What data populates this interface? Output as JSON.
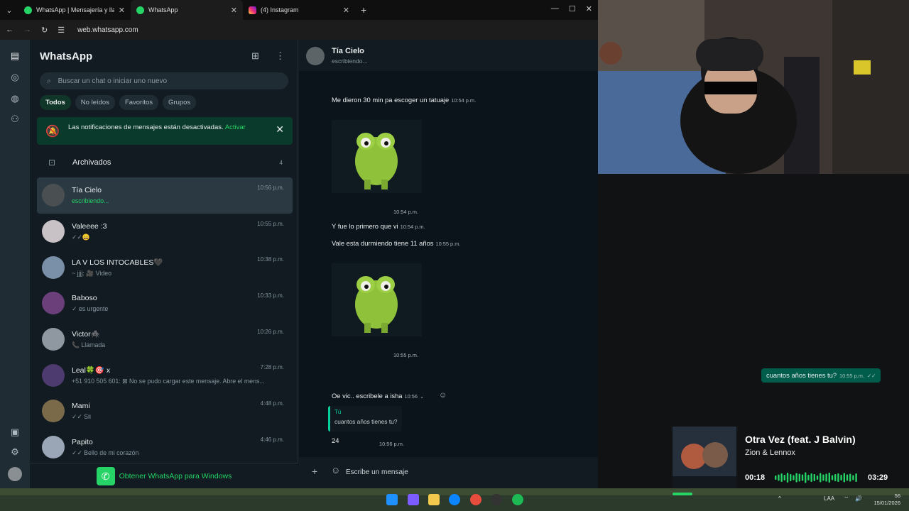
{
  "browser": {
    "tabs": [
      {
        "title": "WhatsApp | Mensajería y llama...",
        "active": false
      },
      {
        "title": "WhatsApp",
        "active": true
      },
      {
        "title": "(4) Instagram",
        "active": false
      }
    ],
    "url": "web.whatsapp.com"
  },
  "sidebar": {
    "title": "WhatsApp",
    "search_placeholder": "Buscar un chat o iniciar uno nuevo",
    "filters": [
      "Todos",
      "No leídos",
      "Favoritos",
      "Grupos"
    ],
    "active_filter": "Todos",
    "notification": {
      "text": "Las notificaciones de mensajes están desactivadas.",
      "action": "Activar"
    },
    "archived": {
      "label": "Archivados",
      "count": "4"
    },
    "chats": [
      {
        "name": "Tía Cielo",
        "preview": "escribiendo...",
        "time": "10:56 p.m.",
        "selected": true,
        "avatar_color": "#4a4f52"
      },
      {
        "name": "Valeeee :3",
        "preview": "✓✓😄",
        "time": "10:55 p.m.",
        "avatar_color": "#c8c2c6"
      },
      {
        "name": "LA V LOS INTOCABLES🖤",
        "preview": "~ jjjj: 🎥 Video",
        "time": "10:38 p.m.",
        "avatar_color": "#7a8fa8"
      },
      {
        "name": "Baboso",
        "preview": "✓ es urgente",
        "time": "10:33 p.m.",
        "avatar_color": "#6b3f7a"
      },
      {
        "name": "Victor🕷️",
        "preview": "📞 Llamada",
        "time": "10:26 p.m.",
        "avatar_color": "#8f97a0"
      },
      {
        "name": "Leal🍀🎯 x",
        "preview": "+51 910 505 601: ⊠ No se pudo cargar este mensaje. Abre el mens...",
        "time": "7:28 p.m.",
        "avatar_color": "#4d3a6e"
      },
      {
        "name": "Mami",
        "preview": "✓✓ Sii",
        "time": "4:48 p.m.",
        "avatar_color": "#7a6a4a"
      },
      {
        "name": "Papito",
        "preview": "✓✓ Bello de mi corazón",
        "time": "4:46 p.m.",
        "avatar_color": "#9aa6b5"
      }
    ],
    "get_windows_label": "Obtener WhatsApp para Windows"
  },
  "conversation": {
    "contact_name": "Tía Cielo",
    "status": "escribiendo...",
    "messages": [
      {
        "text": "Me dieron 30 min pa escoger un tatuaje",
        "time": "10:54 p.m."
      },
      {
        "sticker_time": "10:54 p.m."
      },
      {
        "text": "Y fue lo primero que vi",
        "time": "10:54 p.m."
      },
      {
        "text": "Vale esta durmiendo tiene 11 años",
        "time": "10:55 p.m."
      },
      {
        "sticker_time": "10:55 p.m."
      },
      {
        "text": "Oe vic.. escribele a isha",
        "time": "10:56"
      },
      {
        "reply_author": "Tú",
        "reply_text": "cuantos años tienes tu?",
        "text": "24",
        "time": "10:56 p.m."
      }
    ],
    "outgoing": {
      "text": "cuantos años tienes tu?",
      "time": "10:55 p.m."
    },
    "composer_placeholder": "Escribe un mensaje"
  },
  "spotify": {
    "title": "Otra Vez (feat. J Balvin)",
    "artist": "Zion & Lennox",
    "elapsed": "00:18",
    "duration": "03:29",
    "progress": 0.086
  },
  "taskbar": {
    "lang": "LAA",
    "clock_time": "",
    "date": "15/01/2026",
    "tray_number": "56"
  },
  "colors": {
    "accent": "#25d366",
    "outgoing_bubble": "#005c4b",
    "panel": "#111b21"
  }
}
